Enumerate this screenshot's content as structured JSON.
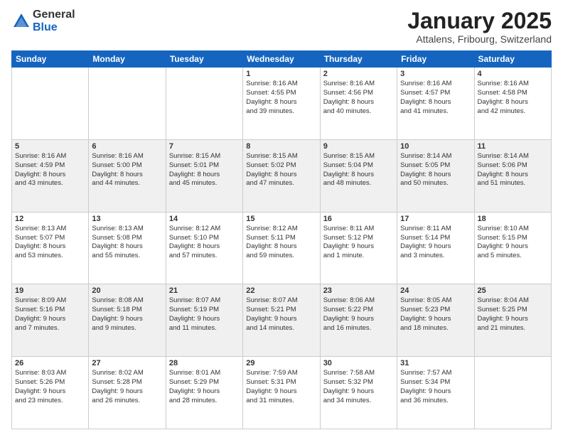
{
  "logo": {
    "general": "General",
    "blue": "Blue"
  },
  "header": {
    "month": "January 2025",
    "location": "Attalens, Fribourg, Switzerland"
  },
  "days_of_week": [
    "Sunday",
    "Monday",
    "Tuesday",
    "Wednesday",
    "Thursday",
    "Friday",
    "Saturday"
  ],
  "weeks": [
    [
      {
        "day": "",
        "info": ""
      },
      {
        "day": "",
        "info": ""
      },
      {
        "day": "",
        "info": ""
      },
      {
        "day": "1",
        "info": "Sunrise: 8:16 AM\nSunset: 4:55 PM\nDaylight: 8 hours\nand 39 minutes."
      },
      {
        "day": "2",
        "info": "Sunrise: 8:16 AM\nSunset: 4:56 PM\nDaylight: 8 hours\nand 40 minutes."
      },
      {
        "day": "3",
        "info": "Sunrise: 8:16 AM\nSunset: 4:57 PM\nDaylight: 8 hours\nand 41 minutes."
      },
      {
        "day": "4",
        "info": "Sunrise: 8:16 AM\nSunset: 4:58 PM\nDaylight: 8 hours\nand 42 minutes."
      }
    ],
    [
      {
        "day": "5",
        "info": "Sunrise: 8:16 AM\nSunset: 4:59 PM\nDaylight: 8 hours\nand 43 minutes."
      },
      {
        "day": "6",
        "info": "Sunrise: 8:16 AM\nSunset: 5:00 PM\nDaylight: 8 hours\nand 44 minutes."
      },
      {
        "day": "7",
        "info": "Sunrise: 8:15 AM\nSunset: 5:01 PM\nDaylight: 8 hours\nand 45 minutes."
      },
      {
        "day": "8",
        "info": "Sunrise: 8:15 AM\nSunset: 5:02 PM\nDaylight: 8 hours\nand 47 minutes."
      },
      {
        "day": "9",
        "info": "Sunrise: 8:15 AM\nSunset: 5:04 PM\nDaylight: 8 hours\nand 48 minutes."
      },
      {
        "day": "10",
        "info": "Sunrise: 8:14 AM\nSunset: 5:05 PM\nDaylight: 8 hours\nand 50 minutes."
      },
      {
        "day": "11",
        "info": "Sunrise: 8:14 AM\nSunset: 5:06 PM\nDaylight: 8 hours\nand 51 minutes."
      }
    ],
    [
      {
        "day": "12",
        "info": "Sunrise: 8:13 AM\nSunset: 5:07 PM\nDaylight: 8 hours\nand 53 minutes."
      },
      {
        "day": "13",
        "info": "Sunrise: 8:13 AM\nSunset: 5:08 PM\nDaylight: 8 hours\nand 55 minutes."
      },
      {
        "day": "14",
        "info": "Sunrise: 8:12 AM\nSunset: 5:10 PM\nDaylight: 8 hours\nand 57 minutes."
      },
      {
        "day": "15",
        "info": "Sunrise: 8:12 AM\nSunset: 5:11 PM\nDaylight: 8 hours\nand 59 minutes."
      },
      {
        "day": "16",
        "info": "Sunrise: 8:11 AM\nSunset: 5:12 PM\nDaylight: 9 hours\nand 1 minute."
      },
      {
        "day": "17",
        "info": "Sunrise: 8:11 AM\nSunset: 5:14 PM\nDaylight: 9 hours\nand 3 minutes."
      },
      {
        "day": "18",
        "info": "Sunrise: 8:10 AM\nSunset: 5:15 PM\nDaylight: 9 hours\nand 5 minutes."
      }
    ],
    [
      {
        "day": "19",
        "info": "Sunrise: 8:09 AM\nSunset: 5:16 PM\nDaylight: 9 hours\nand 7 minutes."
      },
      {
        "day": "20",
        "info": "Sunrise: 8:08 AM\nSunset: 5:18 PM\nDaylight: 9 hours\nand 9 minutes."
      },
      {
        "day": "21",
        "info": "Sunrise: 8:07 AM\nSunset: 5:19 PM\nDaylight: 9 hours\nand 11 minutes."
      },
      {
        "day": "22",
        "info": "Sunrise: 8:07 AM\nSunset: 5:21 PM\nDaylight: 9 hours\nand 14 minutes."
      },
      {
        "day": "23",
        "info": "Sunrise: 8:06 AM\nSunset: 5:22 PM\nDaylight: 9 hours\nand 16 minutes."
      },
      {
        "day": "24",
        "info": "Sunrise: 8:05 AM\nSunset: 5:23 PM\nDaylight: 9 hours\nand 18 minutes."
      },
      {
        "day": "25",
        "info": "Sunrise: 8:04 AM\nSunset: 5:25 PM\nDaylight: 9 hours\nand 21 minutes."
      }
    ],
    [
      {
        "day": "26",
        "info": "Sunrise: 8:03 AM\nSunset: 5:26 PM\nDaylight: 9 hours\nand 23 minutes."
      },
      {
        "day": "27",
        "info": "Sunrise: 8:02 AM\nSunset: 5:28 PM\nDaylight: 9 hours\nand 26 minutes."
      },
      {
        "day": "28",
        "info": "Sunrise: 8:01 AM\nSunset: 5:29 PM\nDaylight: 9 hours\nand 28 minutes."
      },
      {
        "day": "29",
        "info": "Sunrise: 7:59 AM\nSunset: 5:31 PM\nDaylight: 9 hours\nand 31 minutes."
      },
      {
        "day": "30",
        "info": "Sunrise: 7:58 AM\nSunset: 5:32 PM\nDaylight: 9 hours\nand 34 minutes."
      },
      {
        "day": "31",
        "info": "Sunrise: 7:57 AM\nSunset: 5:34 PM\nDaylight: 9 hours\nand 36 minutes."
      },
      {
        "day": "",
        "info": ""
      }
    ]
  ]
}
